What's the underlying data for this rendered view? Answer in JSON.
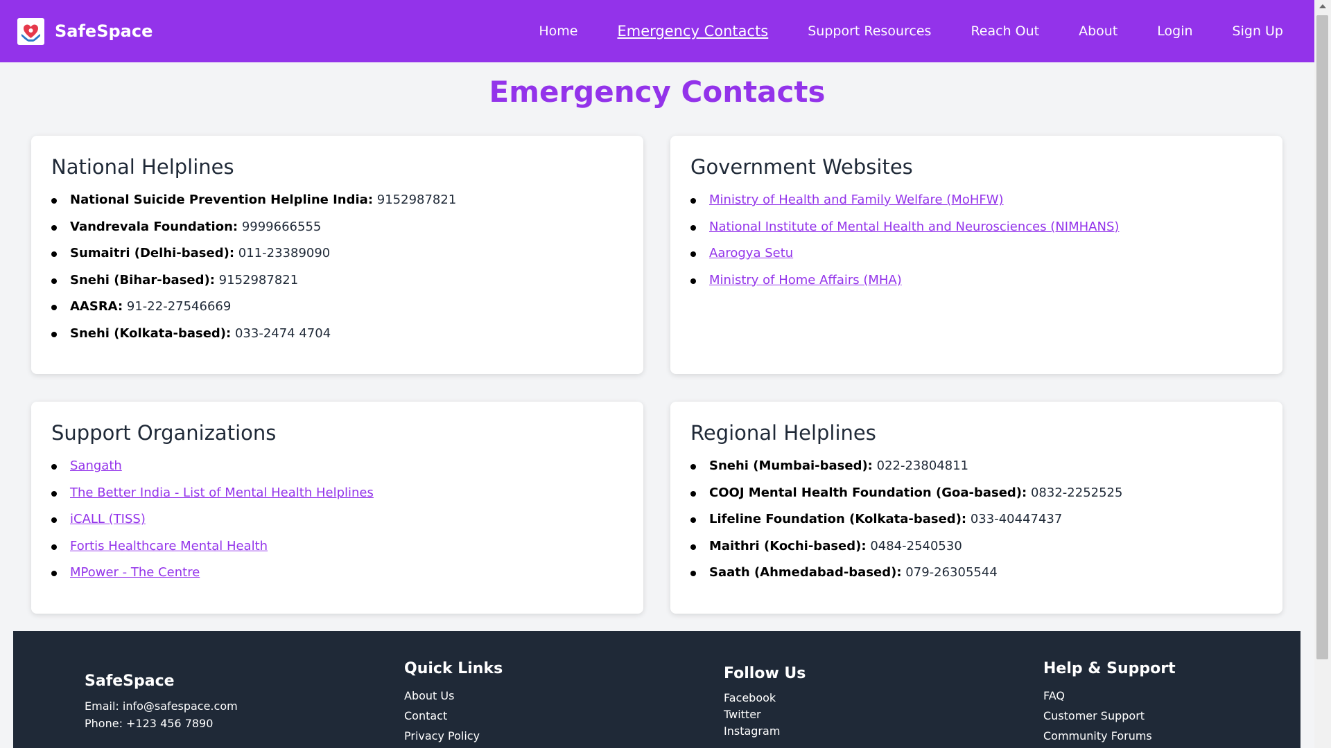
{
  "brand": {
    "name": "SafeSpace",
    "logo_icon": "heart-hands-logo-icon"
  },
  "nav": {
    "items": [
      "Home",
      "Emergency Contacts",
      "Support Resources",
      "Reach Out",
      "About",
      "Login",
      "Sign Up"
    ],
    "active": "Emergency Contacts"
  },
  "page": {
    "title": "Emergency Contacts"
  },
  "cards": {
    "national": {
      "title": "National Helplines",
      "items": [
        {
          "name": "National Suicide Prevention Helpline India:",
          "value": "9152987821"
        },
        {
          "name": "Vandrevala Foundation:",
          "value": "9999666555"
        },
        {
          "name": "Sumaitri (Delhi-based):",
          "value": "011-23389090"
        },
        {
          "name": "Snehi (Bihar-based):",
          "value": "9152987821"
        },
        {
          "name": "AASRA:",
          "value": "91-22-27546669"
        },
        {
          "name": "Snehi (Kolkata-based):",
          "value": "033-2474 4704"
        }
      ]
    },
    "government": {
      "title": "Government Websites",
      "links": [
        "Ministry of Health and Family Welfare (MoHFW)",
        "National Institute of Mental Health and Neurosciences (NIMHANS)",
        "Aarogya Setu",
        "Ministry of Home Affairs (MHA)"
      ]
    },
    "support": {
      "title": "Support Organizations",
      "links": [
        "Sangath",
        "The Better India - List of Mental Health Helplines",
        "iCALL (TISS)",
        "Fortis Healthcare Mental Health",
        "MPower - The Centre"
      ]
    },
    "regional": {
      "title": "Regional Helplines",
      "items": [
        {
          "name": "Snehi (Mumbai-based):",
          "value": "022-23804811"
        },
        {
          "name": "COOJ Mental Health Foundation (Goa-based):",
          "value": "0832-2252525"
        },
        {
          "name": "Lifeline Foundation (Kolkata-based):",
          "value": "033-40447437"
        },
        {
          "name": "Maithri (Kochi-based):",
          "value": "0484-2540530"
        },
        {
          "name": "Saath (Ahmedabad-based):",
          "value": "079-26305544"
        }
      ]
    }
  },
  "footer": {
    "brand": {
      "title": "SafeSpace",
      "email": "Email: info@safespace.com",
      "phone": "Phone: +123 456 7890"
    },
    "quick_links": {
      "title": "Quick Links",
      "links": [
        "About Us",
        "Contact",
        "Privacy Policy"
      ]
    },
    "follow": {
      "title": "Follow Us",
      "links": [
        "Facebook",
        "Twitter",
        "Instagram"
      ]
    },
    "help": {
      "title": "Help & Support",
      "links": [
        "FAQ",
        "Customer Support",
        "Community Forums"
      ]
    }
  },
  "colors": {
    "accent": "#9333ea",
    "footer_bg": "#1f2937",
    "page_bg": "#f3f4f6"
  }
}
